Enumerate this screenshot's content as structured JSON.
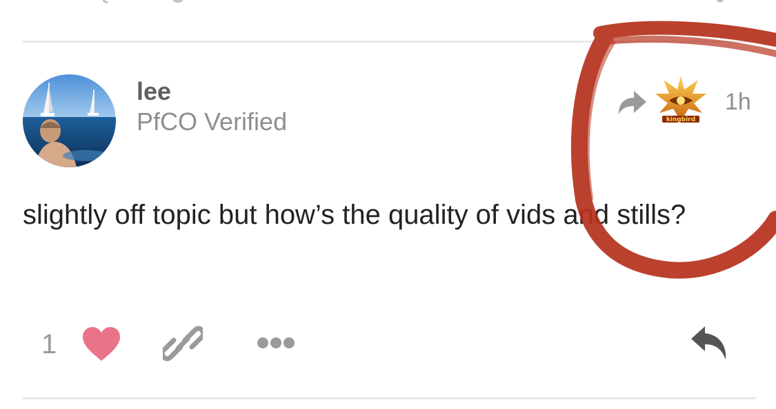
{
  "post": {
    "username": "lee",
    "user_title": "PfCO Verified",
    "relative_time": "1h",
    "body": "slightly off topic but how’s the quality of vids and stills?",
    "reply_to_avatar_text": "kingbird"
  },
  "actions": {
    "like_count": "1",
    "like_icon": "heart-icon",
    "link_icon": "link-icon",
    "more_icon": "more-horizontal-icon",
    "reply_icon": "reply-icon",
    "liked_color": "#e9748a"
  },
  "annotation": {
    "type": "hand-drawn circle",
    "color": "#b5311c"
  }
}
